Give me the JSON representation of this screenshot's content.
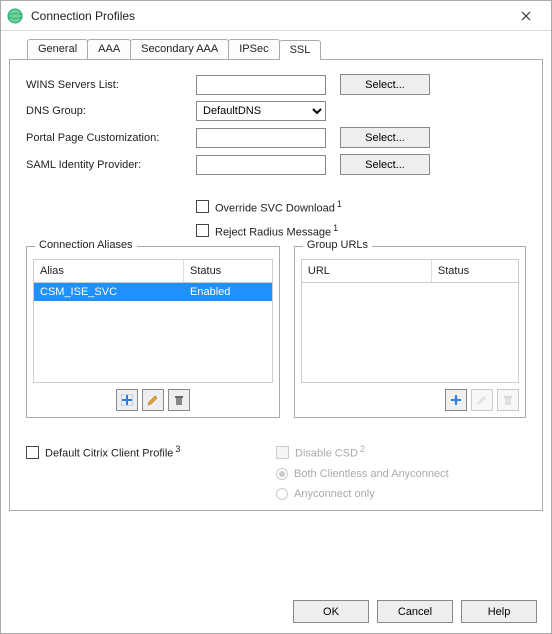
{
  "window": {
    "title": "Connection Profiles"
  },
  "tabs": {
    "t0": "General",
    "t1": "AAA",
    "t2": "Secondary AAA",
    "t3": "IPSec",
    "t4": "SSL"
  },
  "form": {
    "wins_label": "WINS Servers List:",
    "wins_value": "",
    "dns_label": "DNS Group:",
    "dns_value": "DefaultDNS",
    "portal_label": "Portal Page Customization:",
    "portal_value": "",
    "saml_label": "SAML Identity Provider:",
    "saml_value": "",
    "select_btn": "Select...",
    "override_label": "Override SVC Download",
    "reject_label": "Reject Radius Message",
    "sup1": "1"
  },
  "aliases": {
    "title": "Connection Aliases",
    "col_alias": "Alias",
    "col_status": "Status",
    "row0_alias": "CSM_ISE_SVC",
    "row0_status": "Enabled"
  },
  "urls": {
    "title": "Group URLs",
    "col_url": "URL",
    "col_status": "Status"
  },
  "bottom": {
    "citrix_label": "Default Citrix Client Profile",
    "sup3": "3",
    "disable_csd": "Disable CSD",
    "sup2": "2",
    "radio_both": "Both Clientless and Anyconnect",
    "radio_any": "Anyconnect only"
  },
  "buttons": {
    "ok": "OK",
    "cancel": "Cancel",
    "help": "Help"
  }
}
